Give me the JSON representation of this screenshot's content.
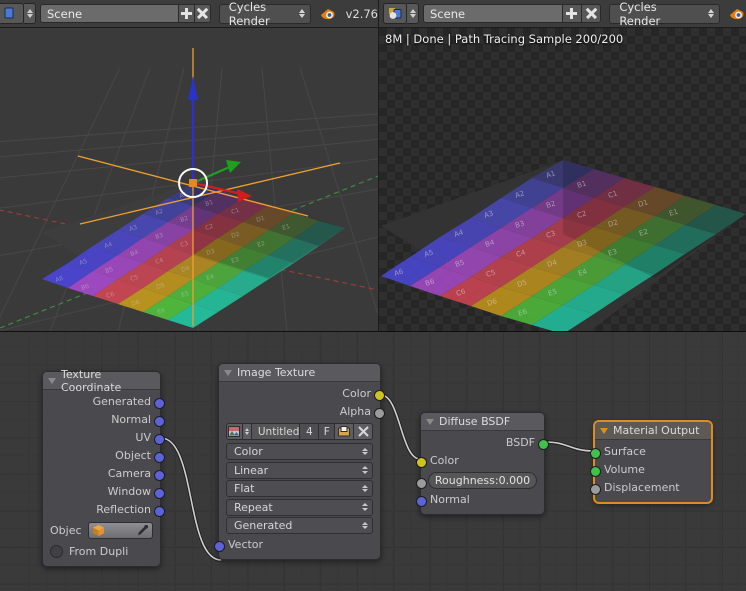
{
  "header": {
    "left": {
      "editor_icon": "3d-view-icon",
      "scene_name": "Scene",
      "new_scene_label": "+",
      "delete_scene_label": "×",
      "engine": "Cycles Render",
      "version": "v2.76",
      "logo": "blender-logo-icon"
    },
    "right": {
      "editor_icon": "uv-image-editor-icon",
      "scene_name": "Scene",
      "new_scene_label": "+",
      "delete_scene_label": "×",
      "engine": "Cycles Render",
      "logo": "blender-logo-icon"
    }
  },
  "viewport_3d": {
    "name": "3d-viewport",
    "background": "#3a3a3a",
    "grid_color": "#4a4a4a",
    "axis_x_color": "#9c3b3b",
    "axis_y_color": "#3b8c3b",
    "manipulator": {
      "z_color": "#2b32c8",
      "y_color": "#1ea01e",
      "x_color": "#d01e1e",
      "outline_color": "#f0a030"
    },
    "cursor": "3d-cursor"
  },
  "render_view": {
    "name": "render-result",
    "info": "8M | Done | Path Tracing Sample 200/200",
    "background": "#262626"
  },
  "node_editor": {
    "name": "shader-node-editor",
    "background": "#3a3a3a",
    "wire_color": "#d0d0d0",
    "nodes": [
      {
        "id": "texture_coordinate",
        "title": "Texture Coordinate",
        "selected": false,
        "outputs": [
          {
            "label": "Generated",
            "color": "#5c63d8"
          },
          {
            "label": "Normal",
            "color": "#5c63d8"
          },
          {
            "label": "UV",
            "color": "#5c63d8"
          },
          {
            "label": "Object",
            "color": "#5c63d8"
          },
          {
            "label": "Camera",
            "color": "#5c63d8"
          },
          {
            "label": "Window",
            "color": "#5c63d8"
          },
          {
            "label": "Reflection",
            "color": "#5c63d8"
          }
        ],
        "object_label": "Objec",
        "object_value": "",
        "from_dupli_label": "From Dupli",
        "from_dupli_checked": false
      },
      {
        "id": "image_texture",
        "title": "Image Texture",
        "selected": false,
        "outputs": [
          {
            "label": "Color",
            "color": "#cfc322"
          },
          {
            "label": "Alpha",
            "color": "#9b9b9b"
          }
        ],
        "image_name": "Untitled",
        "image_users": "4",
        "image_fake_user": "F",
        "color_space": "Color",
        "interpolation": "Linear",
        "projection": "Flat",
        "extension": "Repeat",
        "source": "Generated",
        "inputs": [
          {
            "label": "Vector",
            "color": "#5c63d8"
          }
        ]
      },
      {
        "id": "diffuse_bsdf",
        "title": "Diffuse BSDF",
        "selected": false,
        "outputs": [
          {
            "label": "BSDF",
            "color": "#3fc14a"
          }
        ],
        "inputs": [
          {
            "label": "Color",
            "color": "#cfc322"
          },
          {
            "label": "Roughness:0.000",
            "color": "#9b9b9b",
            "is_slider": true
          },
          {
            "label": "Normal",
            "color": "#5c63d8"
          }
        ]
      },
      {
        "id": "material_output",
        "title": "Material Output",
        "selected": true,
        "inputs": [
          {
            "label": "Surface",
            "color": "#3fc14a"
          },
          {
            "label": "Volume",
            "color": "#3fc14a"
          },
          {
            "label": "Displacement",
            "color": "#9b9b9b"
          }
        ]
      }
    ],
    "links": [
      {
        "from": "texture_coordinate.UV",
        "to": "image_texture.Vector"
      },
      {
        "from": "image_texture.Color",
        "to": "diffuse_bsdf.Color"
      },
      {
        "from": "diffuse_bsdf.BSDF",
        "to": "material_output.Surface"
      }
    ]
  }
}
